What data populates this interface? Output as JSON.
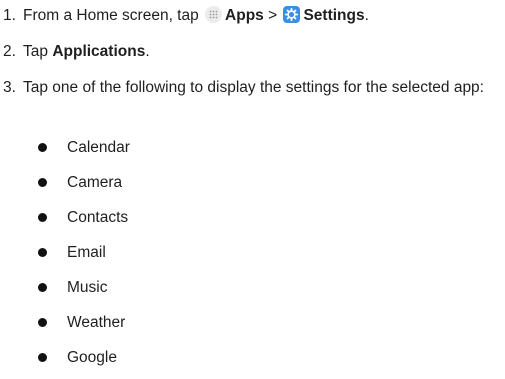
{
  "steps": [
    {
      "number": "1.",
      "pre": "From a Home screen, tap ",
      "apps_label": "Apps",
      "separator": " > ",
      "settings_label": "Settings",
      "post": "."
    },
    {
      "number": "2.",
      "pre": "Tap ",
      "applications_label": "Applications",
      "post": "."
    },
    {
      "number": "3.",
      "text": "Tap one of the following to display the settings for the selected app:"
    }
  ],
  "apps": [
    "Calendar",
    "Camera",
    "Contacts",
    "Email",
    "Music",
    "Weather",
    "Google"
  ],
  "icons": {
    "apps": "apps-grid-icon",
    "settings": "settings-gear-icon",
    "settings_color": "#3a8ee6"
  }
}
